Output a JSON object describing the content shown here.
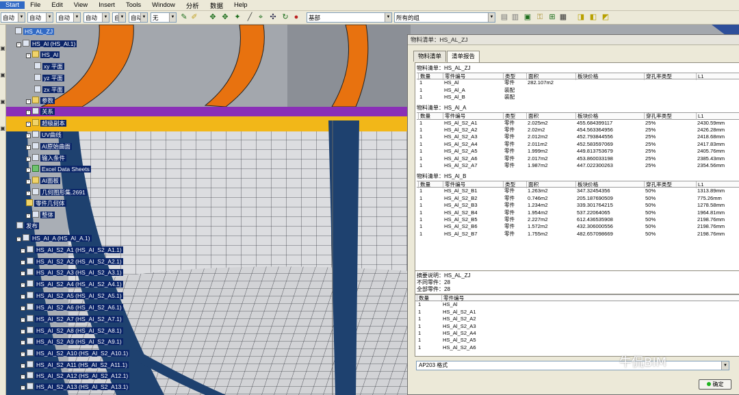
{
  "menu": [
    "Start",
    "File",
    "Edit",
    "View",
    "Insert",
    "Tools",
    "Window",
    "分析",
    "数据",
    "Help"
  ],
  "toolbar": {
    "combos": [
      "自动",
      "自动",
      "自动",
      "自动",
      "自动",
      "自动",
      "无"
    ],
    "layer_combo": "基部",
    "filter_combo": "所有的组"
  },
  "tree": {
    "root": "HS_AL_ZJ",
    "items": [
      "HS_Al (HS_Al.1)",
      "HS_Al",
      "xy 平面",
      "yz 平面",
      "zx 平面",
      "参数",
      "关系",
      "超级副本",
      "UV曲线",
      "AI原始曲面",
      "输入条件",
      "Excel Data Sheets",
      "AI面板",
      "几何图形集.2691",
      "零件几何体",
      "整体",
      "发布",
      "HS_AI_A (HS_AI_A.1)",
      "HS_AI_S2_A1 (HS_AI_S2_A1.1)",
      "HS_AI_S2_A2 (HS_AI_S2_A2.1)",
      "HS_AI_S2_A3 (HS_AI_S2_A3.1)",
      "HS_AI_S2_A4 (HS_AI_S2_A4.1)",
      "HS_AI_S2_A5 (HS_AI_S2_A5.1)",
      "HS_AI_S2_A6 (HS_AI_S2_A6.1)",
      "HS_AI_S2_A7 (HS_AI_S2_A7.1)",
      "HS_AI_S2_A8 (HS_AI_S2_A8.1)",
      "HS_AI_S2_A9 (HS_AI_S2_A9.1)",
      "HS_AI_S2_A10 (HS_AI_S2_A10.1)",
      "HS_AI_S2_A11 (HS_AI_S2_A11.1)",
      "HS_AI_S2_A12 (HS_AI_S2_A12.1)",
      "HS_AI_S2_A13 (HS_AI_S2_A13.1)"
    ]
  },
  "dialog": {
    "title": "物料清单：HS_AL_ZJ",
    "tabs": [
      "物料清单",
      "清单报告"
    ],
    "active_tab": 1,
    "columns": [
      "数量",
      "零件编号",
      "类型",
      "面积",
      "板块价格",
      "穿孔率类型",
      "L1"
    ],
    "sections": [
      {
        "title": "物料清单：HS_AL_ZJ",
        "rows": [
          [
            "1",
            "HS_Al",
            "零件",
            "282.107m2",
            "",
            "",
            ""
          ],
          [
            "1",
            "HS_Al_A",
            "装配",
            "",
            "",
            "",
            ""
          ],
          [
            "1",
            "HS_Al_B",
            "装配",
            "",
            "",
            "",
            ""
          ]
        ]
      },
      {
        "title": "物料清单：HS_Al_A",
        "rows": [
          [
            "1",
            "HS_Al_S2_A1",
            "零件",
            "2.025m2",
            "455.684399117",
            "25%",
            "2430.59mm"
          ],
          [
            "1",
            "HS_Al_S2_A2",
            "零件",
            "2.02m2",
            "454.563364956",
            "25%",
            "2426.28mm"
          ],
          [
            "1",
            "HS_Al_S2_A3",
            "零件",
            "2.012m2",
            "452.793844556",
            "25%",
            "2418.68mm"
          ],
          [
            "1",
            "HS_Al_S2_A4",
            "零件",
            "2.011m2",
            "452.583597069",
            "25%",
            "2417.83mm"
          ],
          [
            "1",
            "HS_Al_S2_A5",
            "零件",
            "1.999m2",
            "449.813753679",
            "25%",
            "2405.76mm"
          ],
          [
            "1",
            "HS_Al_S2_A6",
            "零件",
            "2.017m2",
            "453.860033198",
            "25%",
            "2385.43mm"
          ],
          [
            "1",
            "HS_Al_S2_A7",
            "零件",
            "1.987m2",
            "447.022300263",
            "25%",
            "2354.56mm"
          ]
        ]
      },
      {
        "title": "物料清单：HS_Al_B",
        "rows": [
          [
            "1",
            "HS_Al_S2_B1",
            "零件",
            "1.263m2",
            "347.32454356",
            "50%",
            "1313.89mm"
          ],
          [
            "1",
            "HS_Al_S2_B2",
            "零件",
            "0.746m2",
            "205.187690509",
            "50%",
            "775.26mm"
          ],
          [
            "1",
            "HS_Al_S2_B3",
            "零件",
            "1.234m2",
            "339.301764215",
            "50%",
            "1278.58mm"
          ],
          [
            "1",
            "HS_Al_S2_B4",
            "零件",
            "1.954m2",
            "537.22064065",
            "50%",
            "1964.81mm"
          ],
          [
            "1",
            "HS_Al_S2_B5",
            "零件",
            "2.227m2",
            "612.436535908",
            "50%",
            "2198.76mm"
          ],
          [
            "1",
            "HS_Al_S2_B6",
            "零件",
            "1.572m2",
            "432.306000556",
            "50%",
            "2198.76mm"
          ],
          [
            "1",
            "HS_Al_S2_B7",
            "零件",
            "1.755m2",
            "482.657098669",
            "50%",
            "2198.76mm"
          ]
        ]
      }
    ],
    "summary": {
      "title": "摘要说明：HS_AL_ZJ",
      "different_parts": "不同零件：28",
      "all_parts": "全部零件：28",
      "columns": [
        "数量",
        "零件编号"
      ],
      "rows": [
        [
          "1",
          "HS_Al"
        ],
        [
          "1",
          "HS_Al_S2_A1"
        ],
        [
          "1",
          "HS_Al_S2_A2"
        ],
        [
          "1",
          "HS_Al_S2_A3"
        ],
        [
          "1",
          "HS_Al_S2_A4"
        ],
        [
          "1",
          "HS_Al_S2_A5"
        ],
        [
          "1",
          "HS_Al_S2_A6"
        ]
      ]
    },
    "format": "AP203 格式",
    "ok_label": "确定"
  },
  "watermark": "牛侃BIM"
}
